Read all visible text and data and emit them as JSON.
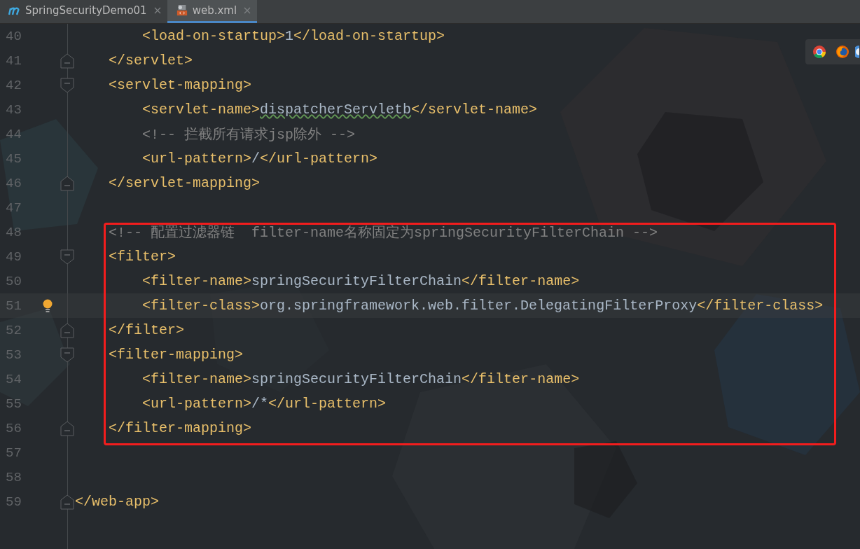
{
  "tabs": [
    {
      "label": "SpringSecurityDemo01",
      "selected": false
    },
    {
      "label": "web.xml",
      "selected": true
    }
  ],
  "code": {
    "blocks": [
      {
        "boxed": false,
        "lines": [
          {
            "number": "40",
            "kind": "plain",
            "segments": [
              {
                "kind": "tag",
                "text": "        <load-on-startup>"
              },
              {
                "kind": "text",
                "text": "1"
              },
              {
                "kind": "tag",
                "text": "</load-on-startup>"
              }
            ]
          },
          {
            "number": "41",
            "kind": "fold-end",
            "segments": [
              {
                "kind": "tag",
                "text": "    </servlet>"
              }
            ]
          },
          {
            "number": "42",
            "kind": "fold-start",
            "segments": [
              {
                "kind": "tag",
                "text": "    <servlet-mapping>"
              }
            ]
          },
          {
            "number": "43",
            "kind": "plain",
            "segments": [
              {
                "kind": "tag",
                "text": "        <servlet-name>"
              },
              {
                "kind": "typo",
                "text": "dispatcherServletb"
              },
              {
                "kind": "tag",
                "text": "</servlet-name>"
              }
            ]
          },
          {
            "number": "44",
            "kind": "plain",
            "segments": [
              {
                "kind": "comment",
                "text": "        <!-- 拦截所有请求jsp除外 -->"
              }
            ]
          },
          {
            "number": "45",
            "kind": "plain",
            "segments": [
              {
                "kind": "tag",
                "text": "        <url-pattern>"
              },
              {
                "kind": "text",
                "text": "/"
              },
              {
                "kind": "tag",
                "text": "</url-pattern>"
              }
            ]
          },
          {
            "number": "46",
            "kind": "fold-end",
            "segments": [
              {
                "kind": "tag",
                "text": "    </servlet-mapping>"
              }
            ]
          },
          {
            "number": "47",
            "kind": "plain"
          }
        ]
      },
      {
        "boxed": true,
        "lines": [
          {
            "number": "48",
            "kind": "plain",
            "segments": [
              {
                "kind": "comment",
                "text": "    <!-- 配置过滤器链  filter-name名称固定为springSecurityFilterChain -->"
              }
            ]
          },
          {
            "number": "49",
            "kind": "fold-start",
            "segments": [
              {
                "kind": "tag",
                "text": "    <filter>"
              }
            ]
          },
          {
            "number": "50",
            "kind": "plain",
            "segments": [
              {
                "kind": "tag",
                "text": "        <filter-name>"
              },
              {
                "kind": "text",
                "text": "springSecurityFilterChain"
              },
              {
                "kind": "tag",
                "text": "</filter-name>"
              }
            ]
          },
          {
            "number": "51",
            "kind": "plain",
            "current": true,
            "bulb": true,
            "segments": [
              {
                "kind": "tag",
                "text": "        <filter-class>"
              },
              {
                "kind": "text",
                "text": "org.springframework.web.filter.DelegatingFilterProxy"
              },
              {
                "kind": "tag",
                "text": "</filter-class>"
              }
            ]
          },
          {
            "number": "52",
            "kind": "fold-end",
            "segments": [
              {
                "kind": "tag",
                "text": "    </filter>"
              }
            ]
          },
          {
            "number": "53",
            "kind": "fold-start",
            "segments": [
              {
                "kind": "tag",
                "text": "    <filter-mapping>"
              }
            ]
          },
          {
            "number": "54",
            "kind": "plain",
            "segments": [
              {
                "kind": "tag",
                "text": "        <filter-name>"
              },
              {
                "kind": "text",
                "text": "springSecurityFilterChain"
              },
              {
                "kind": "tag",
                "text": "</filter-name>"
              }
            ]
          },
          {
            "number": "55",
            "kind": "plain",
            "segments": [
              {
                "kind": "tag",
                "text": "        <url-pattern>"
              },
              {
                "kind": "text",
                "text": "/*"
              },
              {
                "kind": "tag",
                "text": "</url-pattern>"
              }
            ]
          },
          {
            "number": "56",
            "kind": "fold-end",
            "segments": [
              {
                "kind": "tag",
                "text": "    </filter-mapping>"
              }
            ]
          }
        ]
      },
      {
        "boxed": false,
        "lines": [
          {
            "number": "57",
            "kind": "plain"
          },
          {
            "number": "58",
            "kind": "plain"
          },
          {
            "number": "59",
            "kind": "fold-end",
            "segments": [
              {
                "kind": "tag",
                "text": "</web-app>"
              }
            ]
          }
        ]
      }
    ]
  },
  "browser_popup": {
    "browsers": [
      {
        "kind": "chrome"
      },
      {
        "kind": "firefox"
      },
      {
        "kind": "partial"
      }
    ]
  }
}
